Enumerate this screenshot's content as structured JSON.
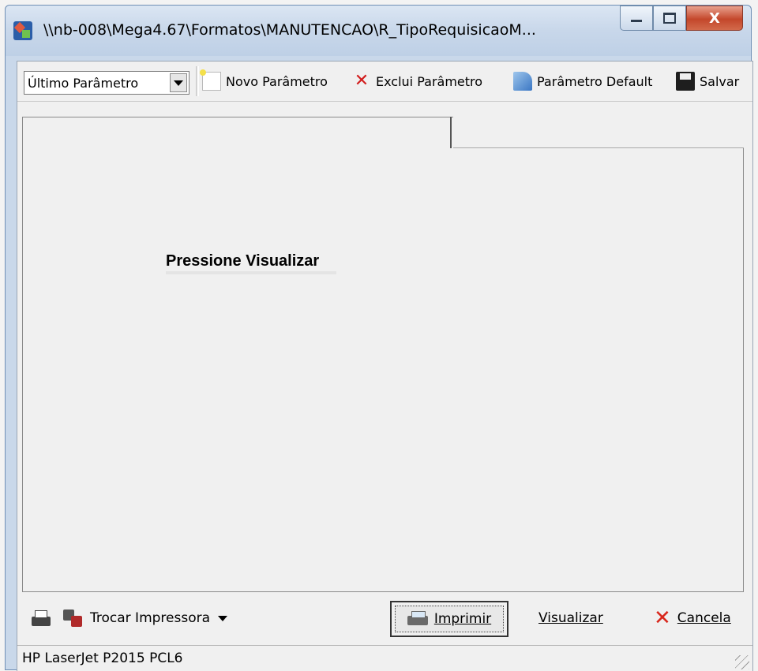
{
  "window": {
    "title": "\\\\nb-008\\Mega4.67\\Formatos\\MANUTENCAO\\R_TipoRequisicaoM...",
    "controls": {
      "minimize": "",
      "maximize": "",
      "close": "X"
    }
  },
  "toolbar": {
    "param_select": {
      "value": "Último Parâmetro"
    },
    "new_label": "Novo Parâmetro",
    "delete_label": "Exclui Parâmetro",
    "default_label": "Parâmetro Default",
    "save_label": "Salvar"
  },
  "panel": {
    "prompt": "Pressione Visualizar"
  },
  "bottom": {
    "switch_printer_label": "Trocar Impressora",
    "print_label": "Imprimir",
    "preview_label": "Visualizar",
    "cancel_label": "Cancela"
  },
  "status": {
    "printer_name": "HP LaserJet P2015 PCL6"
  },
  "colors": {
    "title_gradient_top": "#dbe6f3",
    "close_button": "#c4472b",
    "client_bg": "#f0f0f0",
    "cancel_icon": "#d8261b",
    "delete_icon": "#d21c1c"
  },
  "icons": {
    "app": "app-icon",
    "new": "new-document-icon",
    "delete": "delete-x-icon",
    "default": "default-parameter-icon",
    "save": "floppy-disk-icon",
    "printer": "printer-icon",
    "swap_printer": "swap-printer-icon",
    "print": "print-icon",
    "cancel": "cancel-x-icon"
  }
}
